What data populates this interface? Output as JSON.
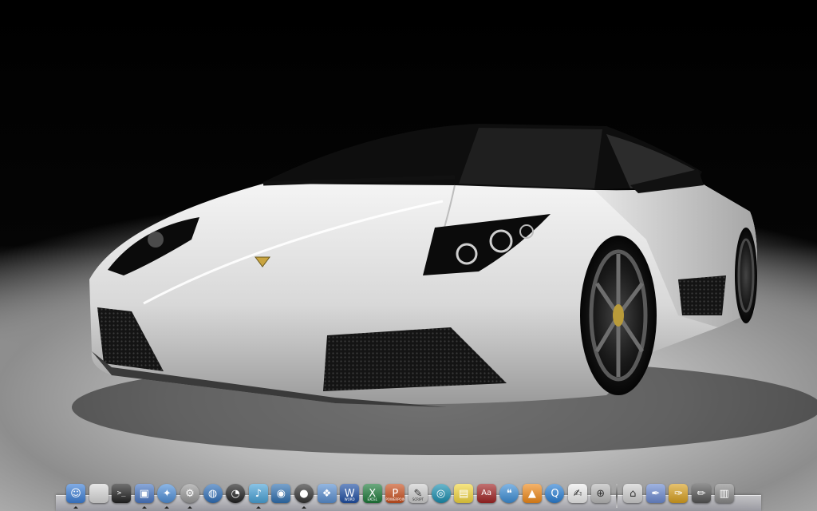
{
  "desktop": {
    "wallpaper_icon": "sports-car-wallpaper"
  },
  "dock": {
    "apps": [
      {
        "key": "finder",
        "icon": "finder-icon",
        "glyph": "☺",
        "bg": "#3d7fd6",
        "running": true
      },
      {
        "key": "apple",
        "icon": "apple-icon",
        "glyph": "",
        "bg": "#d9d9d9",
        "running": false
      },
      {
        "key": "terminal",
        "icon": "terminal-icon",
        "glyph": ">_",
        "bg": "#222222",
        "running": false
      },
      {
        "key": "preview",
        "icon": "preview-icon",
        "glyph": "▣",
        "bg": "#4a78c4",
        "running": true
      },
      {
        "key": "safari",
        "icon": "compass-icon",
        "glyph": "✦",
        "bg": "#4f8fd8",
        "round": true,
        "running": true
      },
      {
        "key": "preferences",
        "icon": "gear-icon",
        "glyph": "⚙",
        "bg": "#9a9a9a",
        "round": true,
        "running": true
      },
      {
        "key": "network",
        "icon": "globe-icon",
        "glyph": "◍",
        "bg": "#2f6fb8",
        "round": true,
        "running": false
      },
      {
        "key": "clock",
        "icon": "clock-icon",
        "glyph": "◔",
        "bg": "#202020",
        "round": true,
        "running": false
      },
      {
        "key": "itunes",
        "icon": "music-note-icon",
        "glyph": "♪",
        "bg": "#4aa3d8",
        "running": true
      },
      {
        "key": "photos",
        "icon": "camera-icon",
        "glyph": "◉",
        "bg": "#3070b0",
        "running": false
      },
      {
        "key": "facetime",
        "icon": "video-camera-icon",
        "glyph": "●",
        "bg": "#333333",
        "round": true,
        "running": true
      },
      {
        "key": "iphoto",
        "icon": "photo-icon",
        "glyph": "❖",
        "bg": "#5a8fd0",
        "running": false
      },
      {
        "key": "word",
        "icon": "word-icon",
        "glyph": "W",
        "bg": "#1f4fa3",
        "running": false
      },
      {
        "key": "excel",
        "icon": "excel-icon",
        "glyph": "X",
        "bg": "#1d7a3a",
        "running": false
      },
      {
        "key": "powerpoint",
        "icon": "powerpoint-icon",
        "glyph": "P",
        "bg": "#c8501f",
        "running": false
      },
      {
        "key": "script",
        "icon": "script-icon",
        "glyph": "✎",
        "bg": "#cfcfcf",
        "running": false
      },
      {
        "key": "vortex",
        "icon": "vortex-icon",
        "glyph": "◎",
        "bg": "#1a8fb0",
        "round": true,
        "running": false
      },
      {
        "key": "stickies",
        "icon": "sticky-notes-icon",
        "glyph": "▤",
        "bg": "#f2d640",
        "running": false
      },
      {
        "key": "dictionary",
        "icon": "dictionary-icon",
        "glyph": "Aa",
        "bg": "#a02424",
        "running": false
      },
      {
        "key": "chat",
        "icon": "chat-bubble-icon",
        "glyph": "❝",
        "bg": "#3d8ed6",
        "round": true,
        "running": false
      },
      {
        "key": "vlc",
        "icon": "traffic-cone-icon",
        "glyph": "▲",
        "bg": "#f08a1a",
        "running": false
      },
      {
        "key": "quicktime",
        "icon": "quicktime-icon",
        "glyph": "Q",
        "bg": "#2a7fd4",
        "round": true,
        "running": false
      },
      {
        "key": "textedit",
        "icon": "document-pen-icon",
        "glyph": "✍",
        "bg": "#eeeeee",
        "running": false
      },
      {
        "key": "diskutil",
        "icon": "stethoscope-icon",
        "glyph": "⊕",
        "bg": "#b9b9b9",
        "running": false
      }
    ],
    "stacks": [
      {
        "key": "home",
        "icon": "house-icon",
        "glyph": "⌂",
        "bg": "#d0d0d0"
      },
      {
        "key": "pen-tool",
        "icon": "pen-tool-icon",
        "glyph": "✒",
        "bg": "#6c8ad0"
      },
      {
        "key": "quill",
        "icon": "quill-icon",
        "glyph": "✑",
        "bg": "#d8a020"
      },
      {
        "key": "pencil",
        "icon": "pencil-icon",
        "glyph": "✏",
        "bg": "#555555"
      },
      {
        "key": "trash",
        "icon": "trash-icon",
        "glyph": "▥",
        "bg": "#8a8a8a"
      }
    ]
  },
  "labels": {
    "word": "WORD",
    "excel": "EXCEL",
    "powerpoint": "POWERPOINT",
    "script": "SCRIPT"
  }
}
